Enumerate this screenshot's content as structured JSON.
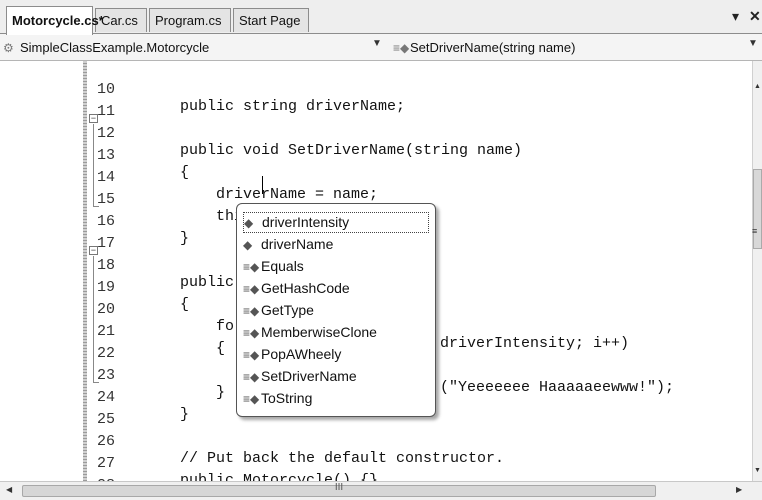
{
  "tabs": [
    {
      "label": "Motorcycle.cs*",
      "active": true
    },
    {
      "label": "Car.cs",
      "active": false
    },
    {
      "label": "Program.cs",
      "active": false
    },
    {
      "label": "Start Page",
      "active": false
    }
  ],
  "tab_controls": {
    "dropdown": "▾",
    "close": "✕"
  },
  "navbar": {
    "type_combo": {
      "icon": "class-icon",
      "value": "SimpleClassExample.Motorcycle"
    },
    "member_combo": {
      "icon": "method-icon",
      "value": "SetDriverName(string name)"
    }
  },
  "editor": {
    "lines": [
      {
        "num": "10",
        "code": "public string driverName;"
      },
      {
        "num": "11",
        "code": ""
      },
      {
        "num": "12",
        "code": "public void SetDriverName(string name)"
      },
      {
        "num": "13",
        "code": "{"
      },
      {
        "num": "14",
        "code": "    driverName = name;"
      },
      {
        "num": "15",
        "code": "    this.driverName = name;"
      },
      {
        "num": "16",
        "code": "}"
      },
      {
        "num": "17",
        "code": ""
      },
      {
        "num": "18",
        "code": "public"
      },
      {
        "num": "19",
        "code": "{"
      },
      {
        "num": "20",
        "code": "    fo"
      },
      {
        "num": "21",
        "code": "    {"
      },
      {
        "num": "22",
        "code": ""
      },
      {
        "num": "23",
        "code": "    }"
      },
      {
        "num": "24",
        "code": "}"
      },
      {
        "num": "25",
        "code": ""
      },
      {
        "num": "26",
        "code": "// Put back the default constructor."
      },
      {
        "num": "27",
        "code": "public Motorcycle() {}"
      },
      {
        "num": "28",
        "code": ""
      }
    ],
    "line20_tail": "driverIntensity; i++)",
    "line22_tail": "(\"Yeeeeeee Haaaaaeewww!\");"
  },
  "intellisense": {
    "items": [
      {
        "label": "driverIntensity",
        "icon": "field-icon",
        "selected": true
      },
      {
        "label": "driverName",
        "icon": "field-icon",
        "selected": false
      },
      {
        "label": "Equals",
        "icon": "method-icon",
        "selected": false
      },
      {
        "label": "GetHashCode",
        "icon": "method-icon",
        "selected": false
      },
      {
        "label": "GetType",
        "icon": "method-icon",
        "selected": false
      },
      {
        "label": "MemberwiseClone",
        "icon": "protected-method-icon",
        "selected": false
      },
      {
        "label": "PopAWheely",
        "icon": "method-icon",
        "selected": false
      },
      {
        "label": "SetDriverName",
        "icon": "method-icon",
        "selected": false
      },
      {
        "label": "ToString",
        "icon": "method-icon",
        "selected": false
      }
    ]
  },
  "scrollbars": {
    "hgrip": "III"
  }
}
